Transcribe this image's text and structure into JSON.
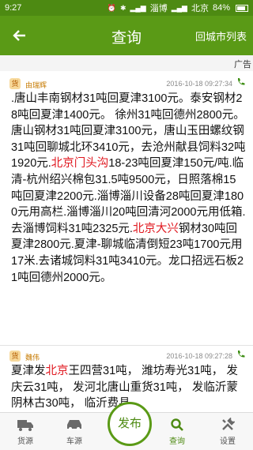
{
  "status_bar": {
    "time": "9:27",
    "carrier": "淄博",
    "location": "北京",
    "battery": "84%"
  },
  "header": {
    "title": "查询",
    "city_list": "回城市列表"
  },
  "ad_strip": {
    "text": "广告"
  },
  "messages": [
    {
      "author": "由瑞辉",
      "avatar": "货",
      "time": "2016-10-18 09:27:34",
      "parts": [
        {
          "t": ".唐山丰南钢材31吨回夏津3100元。泰安钢材28吨回夏津1400元。 徐州31吨回德州2800元。 唐山钢材31吨回夏津3100元，唐山玉田螺纹钢31吨回聊城北环3410元，去沧州献县饲料32吨1920元."
        },
        {
          "t": "北京门头沟",
          "hl": true
        },
        {
          "t": "18-23吨回夏津150元/吨.临清-杭州绍兴棉包31.5吨9500元，日照落棉15吨回夏津2200元.淄博淄川设备28吨回夏津1800元用高栏.淄博淄川20吨回清河2000元用低箱.去淄博饲料31吨2325元."
        },
        {
          "t": "北京大兴",
          "hl": true
        },
        {
          "t": "钢材30吨回夏津2800元.夏津-聊城临清倒短23吨1700元用17米.去诸城饲料31吨3410元。龙口招远石板21吨回德州2000元。"
        }
      ]
    },
    {
      "author": "魏伟",
      "avatar": "货",
      "time": "2016-10-18 09:27:28",
      "parts": [
        {
          "t": "夏津发"
        },
        {
          "t": "北京",
          "hl": true
        },
        {
          "t": "王四营31吨， 潍坊寿光31吨， 发庆云31吨， 发河北唐山重货31吨， 发临沂蒙阴林古30吨， 临沂费县"
        }
      ]
    }
  ],
  "tabs": [
    {
      "label": "货源",
      "icon": "truck-icon"
    },
    {
      "label": "车源",
      "icon": "car-icon"
    },
    {
      "label": "发布",
      "icon": "publish-button"
    },
    {
      "label": "查询",
      "icon": "search-icon"
    },
    {
      "label": "设置",
      "icon": "settings-icon"
    }
  ],
  "colors": {
    "header": "#5a9a16",
    "status_bar": "#4d8a12",
    "highlight": "#e0171f",
    "author": "#c67a00"
  }
}
